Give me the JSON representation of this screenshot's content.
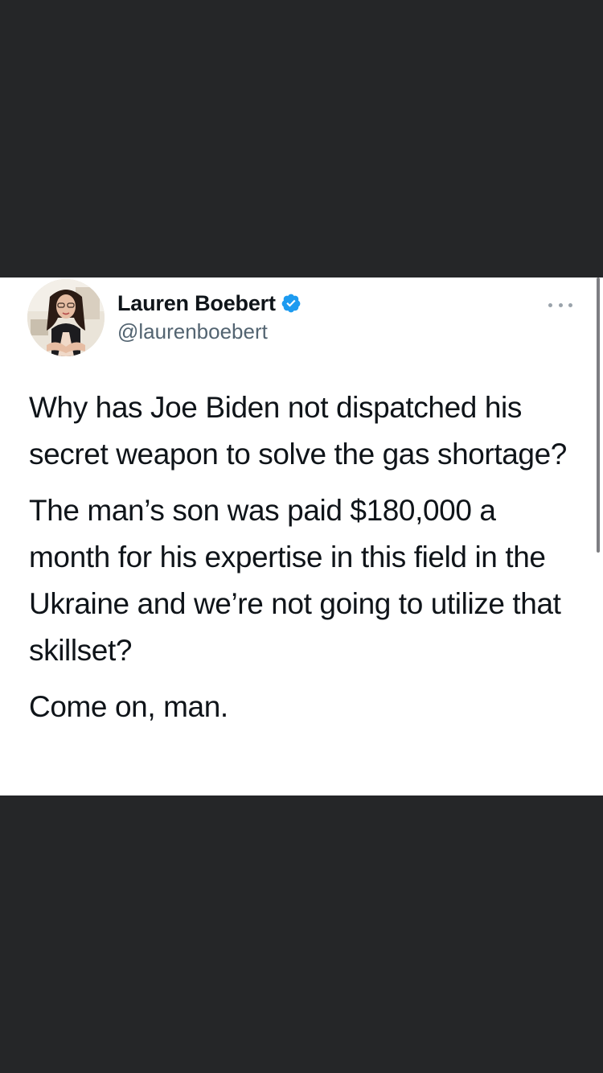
{
  "tweet": {
    "author": {
      "display_name": "Lauren Boebert",
      "handle": "@laurenboebert",
      "verified": true,
      "verified_icon": "verified-badge-icon",
      "verified_color": "#1d9bf0"
    },
    "more_icon": "more-options-icon",
    "paragraphs": [
      "Why has Joe Biden not dispatched his secret weapon to solve the gas shortage?",
      "The man’s son was paid $180,000 a month for his expertise in this field in the Ukraine and we’re not going to utilize that skillset?",
      "Come on, man."
    ]
  },
  "colors": {
    "background": "#252628",
    "card": "#ffffff",
    "text": "#0f1419",
    "secondary_text": "#536471"
  }
}
